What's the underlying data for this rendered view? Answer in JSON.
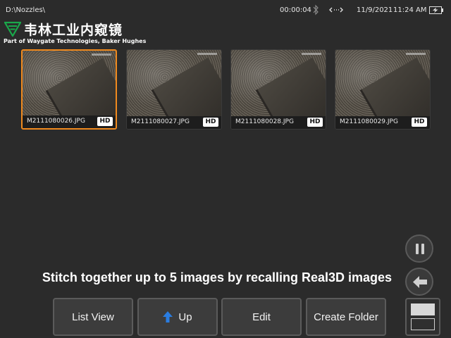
{
  "status_bar": {
    "path": "D:\\Nozzles\\",
    "timer": "00:00:04",
    "date": "11/9/2021",
    "time": "11:24 AM",
    "icons": [
      "bluetooth-icon",
      "network-icon",
      "battery-charging-icon"
    ]
  },
  "branding": {
    "name": "韦林工业内窥镜",
    "subtitle": "Part of Waygate Technologies, Baker Hughes",
    "accent_color": "#1aa84b"
  },
  "thumbnails": [
    {
      "filename": "M2111080026.JPG",
      "badge": "HD",
      "selected": true
    },
    {
      "filename": "M2111080027.JPG",
      "badge": "HD",
      "selected": false
    },
    {
      "filename": "M2111080028.JPG",
      "badge": "HD",
      "selected": false
    },
    {
      "filename": "M2111080029.JPG",
      "badge": "HD",
      "selected": false
    }
  ],
  "caption": "Stitch together up to 5 images by recalling Real3D images",
  "buttons": {
    "list_view": "List View",
    "up": "Up",
    "edit": "Edit",
    "create_folder": "Create Folder"
  },
  "colors": {
    "selection": "#f08a1e",
    "background": "#2b2b2b",
    "up_arrow": "#2a7de1"
  }
}
